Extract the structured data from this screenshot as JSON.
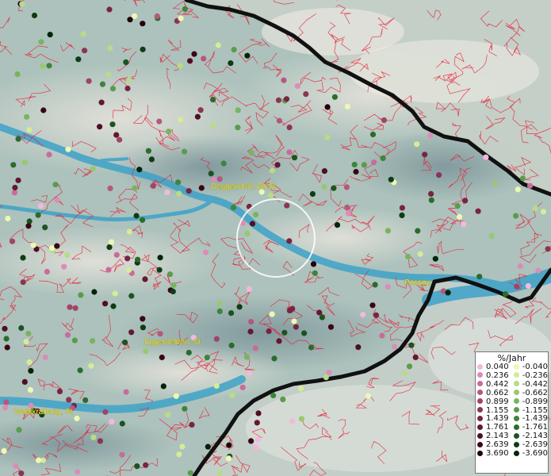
{
  "places": [
    {
      "name": "Deggendorf, GKSt"
    },
    {
      "name": "Passau"
    },
    {
      "name": "Eggenfelden, St"
    },
    {
      "name": "Waldkraiburg, St"
    }
  ],
  "legend": {
    "title": "%/Jahr",
    "positive": [
      {
        "label": "0.040",
        "color": "#f2b8e0"
      },
      {
        "label": "0.236",
        "color": "#dc8cb8"
      },
      {
        "label": "0.442",
        "color": "#c86c98"
      },
      {
        "label": "0.662",
        "color": "#b45880"
      },
      {
        "label": "0.899",
        "color": "#a04468"
      },
      {
        "label": "1.155",
        "color": "#8c3454"
      },
      {
        "label": "1.439",
        "color": "#782442"
      },
      {
        "label": "1.761",
        "color": "#641830"
      },
      {
        "label": "2.143",
        "color": "#500e22"
      },
      {
        "label": "2.639",
        "color": "#3a0614"
      },
      {
        "label": "3.690",
        "color": "#22020a"
      }
    ],
    "negative": [
      {
        "label": "-0.040",
        "color": "#eef8b4"
      },
      {
        "label": "-0.236",
        "color": "#d4ec98"
      },
      {
        "label": "-0.442",
        "color": "#b8dc84"
      },
      {
        "label": "-0.662",
        "color": "#98c870"
      },
      {
        "label": "-0.899",
        "color": "#78b460"
      },
      {
        "label": "-1.155",
        "color": "#5a9c4c"
      },
      {
        "label": "-1.439",
        "color": "#3e843c"
      },
      {
        "label": "-1.761",
        "color": "#2a6c2c"
      },
      {
        "label": "-2.143",
        "color": "#1a5420"
      },
      {
        "label": "-2.639",
        "color": "#0e3c14"
      },
      {
        "label": "-3.690",
        "color": "#04240a"
      }
    ]
  }
}
